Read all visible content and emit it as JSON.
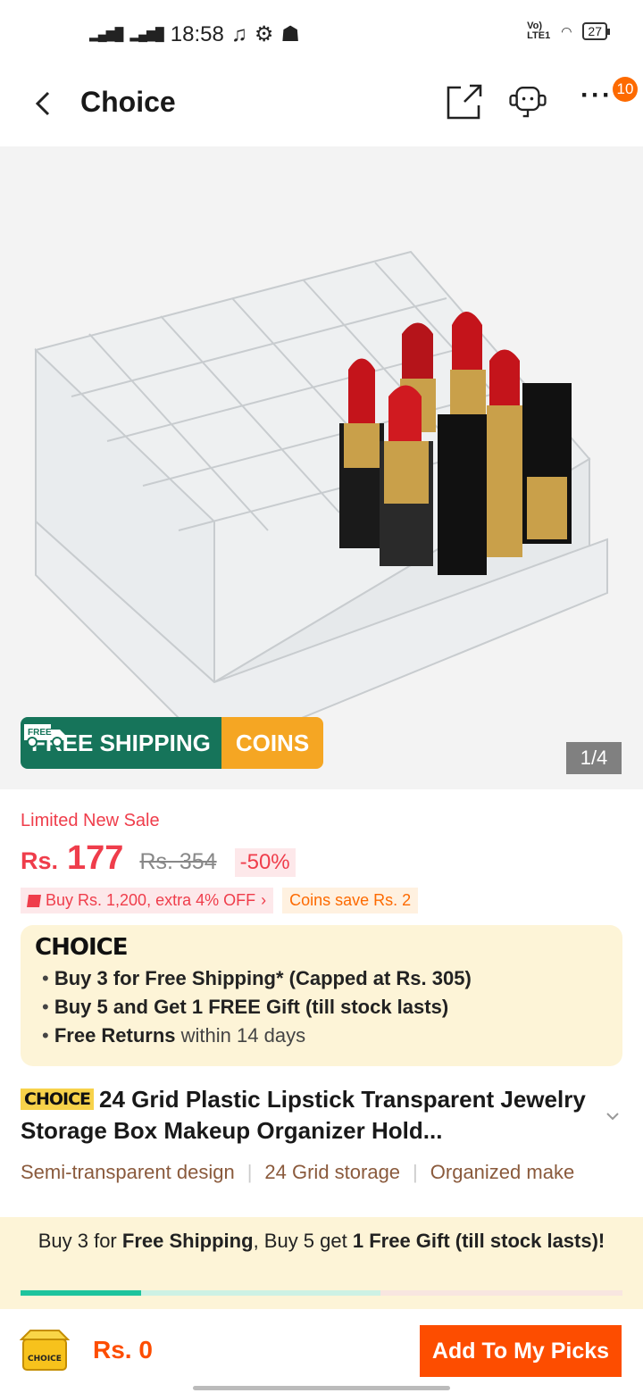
{
  "status_bar": {
    "time": "18:58",
    "battery": "27"
  },
  "header": {
    "title": "Choice",
    "more_badge": "10"
  },
  "gallery": {
    "free_shipping_label": "FREE SHIPPING",
    "free_tag": "FREE",
    "coins_label": "COINS",
    "pager": "1/4"
  },
  "pricing": {
    "limited_label": "Limited New Sale",
    "currency": "Rs.",
    "price": "177",
    "original_price": "Rs. 354",
    "discount": "-50%",
    "promo": "Buy Rs. 1,200, extra 4% OFF",
    "coins_save": "Coins save Rs. 2"
  },
  "choice_box": {
    "logo": "CHOICE",
    "bullets": [
      {
        "bold": "Buy 3 for  Free Shipping* (Capped at Rs. 305)",
        "rest": ""
      },
      {
        "bold": "Buy 5 and Get 1 FREE Gift (till stock lasts)",
        "rest": ""
      },
      {
        "bold": "Free Returns",
        "rest": " within 14 days"
      }
    ]
  },
  "product": {
    "choice_tag": "CHOICE",
    "title": "24 Grid Plastic Lipstick Transparent Jewelry Storage Box Makeup Organizer Hold...",
    "features": [
      "Semi-transparent design",
      "24 Grid storage",
      "Organized make"
    ]
  },
  "banner": {
    "t1": "Buy 3 for ",
    "t2": "Free Shipping",
    "t3": ", Buy 5 get ",
    "t4": "1 Free Gift (till stock lasts)!",
    "progress": 0.2
  },
  "bottom_bar": {
    "box_label": "CHOICE",
    "total": "Rs. 0",
    "add_button": "Add To My Picks"
  },
  "colors": {
    "accent": "#fd4d00",
    "sale_red": "#ef3d4b",
    "shipping_green": "#16745a",
    "coins_yellow": "#f5a623"
  }
}
